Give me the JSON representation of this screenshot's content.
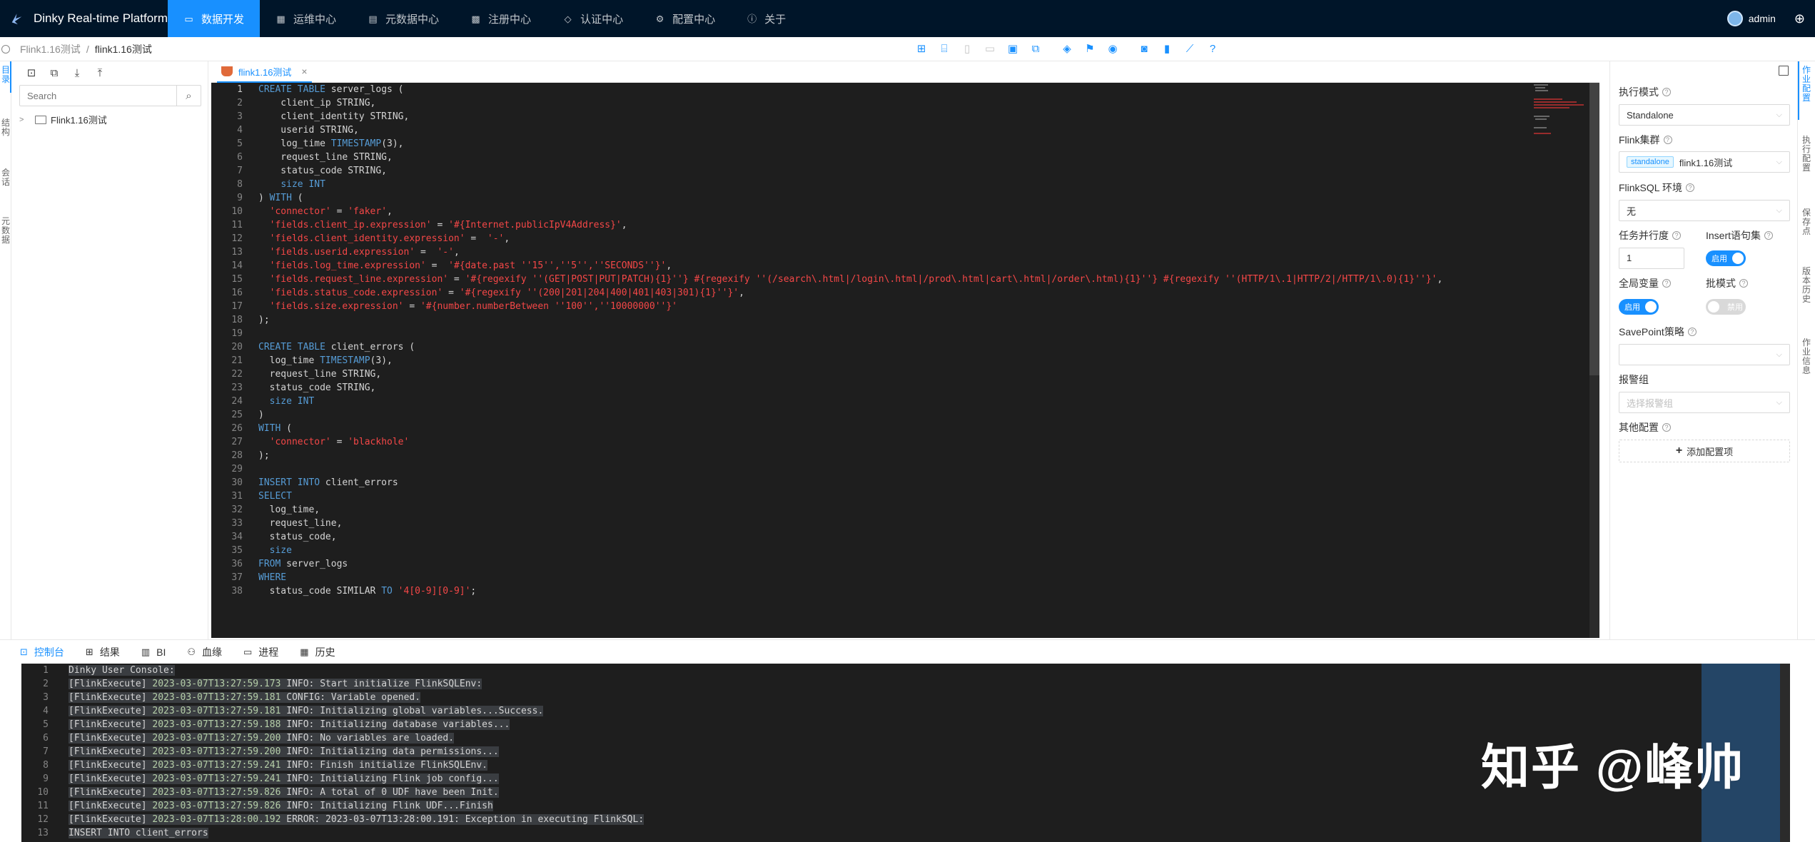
{
  "app": {
    "brand": "Dinky Real-time Platform",
    "nav": [
      {
        "label": "数据开发",
        "icon": "code-window-icon",
        "active": true
      },
      {
        "label": "运维中心",
        "icon": "dashboard-icon",
        "active": false
      },
      {
        "label": "元数据中心",
        "icon": "database-icon",
        "active": false
      },
      {
        "label": "注册中心",
        "icon": "grid-icon",
        "active": false
      },
      {
        "label": "认证中心",
        "icon": "shield-icon",
        "active": false
      },
      {
        "label": "配置中心",
        "icon": "gear-icon",
        "active": false
      },
      {
        "label": "关于",
        "icon": "info-icon",
        "active": false
      }
    ],
    "user": "admin",
    "colors": {
      "header": "#001529",
      "accent": "#1890ff",
      "editor_bg": "#1e1e1e"
    }
  },
  "breadcrumb": {
    "root": "Flink1.16测试",
    "current": "flink1.16测试"
  },
  "left_rail": {
    "items": [
      "目录",
      "结构",
      "会话",
      "元数据"
    ]
  },
  "left_panel": {
    "search_placeholder": "Search",
    "tree": [
      {
        "label": "Flink1.16测试",
        "type": "folder"
      }
    ]
  },
  "editor": {
    "tab_label": "flink1.16测试",
    "lines": [
      "<k>CREATE TABLE</k> server_logs (",
      "    client_ip STRING,",
      "    client_identity STRING,",
      "    userid STRING,",
      "    log_time <k>TIMESTAMP</k>(3),",
      "    request_line STRING,",
      "    status_code STRING,",
      "    <k>size INT</k>",
      ") <k>WITH</k> (",
      "  <s>'connector'</s> = <s>'faker'</s>,",
      "  <s>'fields.client_ip.expression'</s> = <s>'#{Internet.publicIpV4Address}'</s>,",
      "  <s>'fields.client_identity.expression'</s> =  <s>'-'</s>,",
      "  <s>'fields.userid.expression'</s> =  <s>'-'</s>,",
      "  <s>'fields.log_time.expression'</s> =  <s>'#{date.past ''15'',''5'',''SECONDS''}'</s>,",
      "  <s>'fields.request_line.expression'</s> = <s>'#{regexify ''(GET|POST|PUT|PATCH){1}''} #{regexify ''(/search\\.html|/login\\.html|/prod\\.html|cart\\.html|/order\\.html){1}''} #{regexify ''(HTTP/1\\.1|HTTP/2|/HTTP/1\\.0){1}''}'</s>,",
      "  <s>'fields.status_code.expression'</s> = <s>'#{regexify ''(200|201|204|400|401|403|301){1}''}'</s>,",
      "  <s>'fields.size.expression'</s> = <s>'#{number.numberBetween ''100'',''10000000''}'</s>",
      ");",
      "",
      "<k>CREATE TABLE</k> client_errors (",
      "  log_time <k>TIMESTAMP</k>(3),",
      "  request_line STRING,",
      "  status_code STRING,",
      "  <k>size INT</k>",
      ")",
      "<k>WITH</k> (",
      "  <s>'connector'</s> = <s>'blackhole'</s>",
      ");",
      "",
      "<k>INSERT INTO</k> client_errors",
      "<k>SELECT</k>",
      "  log_time,",
      "  request_line,",
      "  status_code,",
      "  <k>size</k>",
      "<k>FROM</k> server_logs",
      "<k>WHERE</k>",
      "  status_code SIMILAR <k>TO</k> <s>'4[0-9][0-9]'</s>;"
    ]
  },
  "config": {
    "exec_mode_label": "执行模式",
    "exec_mode_value": "Standalone",
    "cluster_label": "Flink集群",
    "cluster_tag": "standalone",
    "cluster_value": "flink1.16测试",
    "env_label": "FlinkSQL 环境",
    "env_value": "无",
    "parallel_label": "任务并行度",
    "parallel_value": "1",
    "insert_label": "Insert语句集",
    "insert_switch": "启用",
    "global_var_label": "全局变量",
    "global_var_switch": "启用",
    "batch_label": "批模式",
    "batch_switch": "禁用",
    "savepoint_label": "SavePoint策略",
    "alert_label": "报警组",
    "alert_placeholder": "选择报警组",
    "other_label": "其他配置",
    "add_label": "添加配置项"
  },
  "right_rail": {
    "items": [
      "作业配置",
      "执行配置",
      "保存点",
      "版本历史",
      "作业信息"
    ]
  },
  "bottom_tabs": [
    {
      "label": "控制台",
      "icon": "console-icon",
      "active": true
    },
    {
      "label": "结果",
      "icon": "table-icon",
      "active": false
    },
    {
      "label": "BI",
      "icon": "bar-chart-icon",
      "active": false
    },
    {
      "label": "血缘",
      "icon": "lineage-icon",
      "active": false
    },
    {
      "label": "进程",
      "icon": "monitor-icon",
      "active": false
    },
    {
      "label": "历史",
      "icon": "calendar-icon",
      "active": false
    }
  ],
  "console": {
    "lines": [
      {
        "prefix": "Dinky User Console:",
        "ts": "",
        "msg": ""
      },
      {
        "prefix": "[FlinkExecute] ",
        "ts": "2023-03-07T13:27:59.173",
        "msg": " INFO: Start initialize FlinkSQLEnv:"
      },
      {
        "prefix": "[FlinkExecute] ",
        "ts": "2023-03-07T13:27:59.181",
        "msg": " CONFIG: Variable opened."
      },
      {
        "prefix": "[FlinkExecute] ",
        "ts": "2023-03-07T13:27:59.181",
        "msg": " INFO: Initializing global variables...Success."
      },
      {
        "prefix": "[FlinkExecute] ",
        "ts": "2023-03-07T13:27:59.188",
        "msg": " INFO: Initializing database variables..."
      },
      {
        "prefix": "[FlinkExecute] ",
        "ts": "2023-03-07T13:27:59.200",
        "msg": " INFO: No variables are loaded."
      },
      {
        "prefix": "[FlinkExecute] ",
        "ts": "2023-03-07T13:27:59.200",
        "msg": " INFO: Initializing data permissions..."
      },
      {
        "prefix": "[FlinkExecute] ",
        "ts": "2023-03-07T13:27:59.241",
        "msg": " INFO: Finish initialize FlinkSQLEnv."
      },
      {
        "prefix": "[FlinkExecute] ",
        "ts": "2023-03-07T13:27:59.241",
        "msg": " INFO: Initializing Flink job config..."
      },
      {
        "prefix": "[FlinkExecute] ",
        "ts": "2023-03-07T13:27:59.826",
        "msg": " INFO: A total of 0 UDF have been Init."
      },
      {
        "prefix": "[FlinkExecute] ",
        "ts": "2023-03-07T13:27:59.826",
        "msg": " INFO: Initializing Flink UDF...Finish"
      },
      {
        "prefix": "[FlinkExecute] ",
        "ts": "2023-03-07T13:28:00.192",
        "msg": " ERROR: 2023-03-07T13:28:00.191: Exception in executing FlinkSQL:"
      },
      {
        "prefix": "INSERT INTO client_errors",
        "ts": "",
        "msg": ""
      }
    ]
  },
  "watermark": "知乎 @峰帅"
}
